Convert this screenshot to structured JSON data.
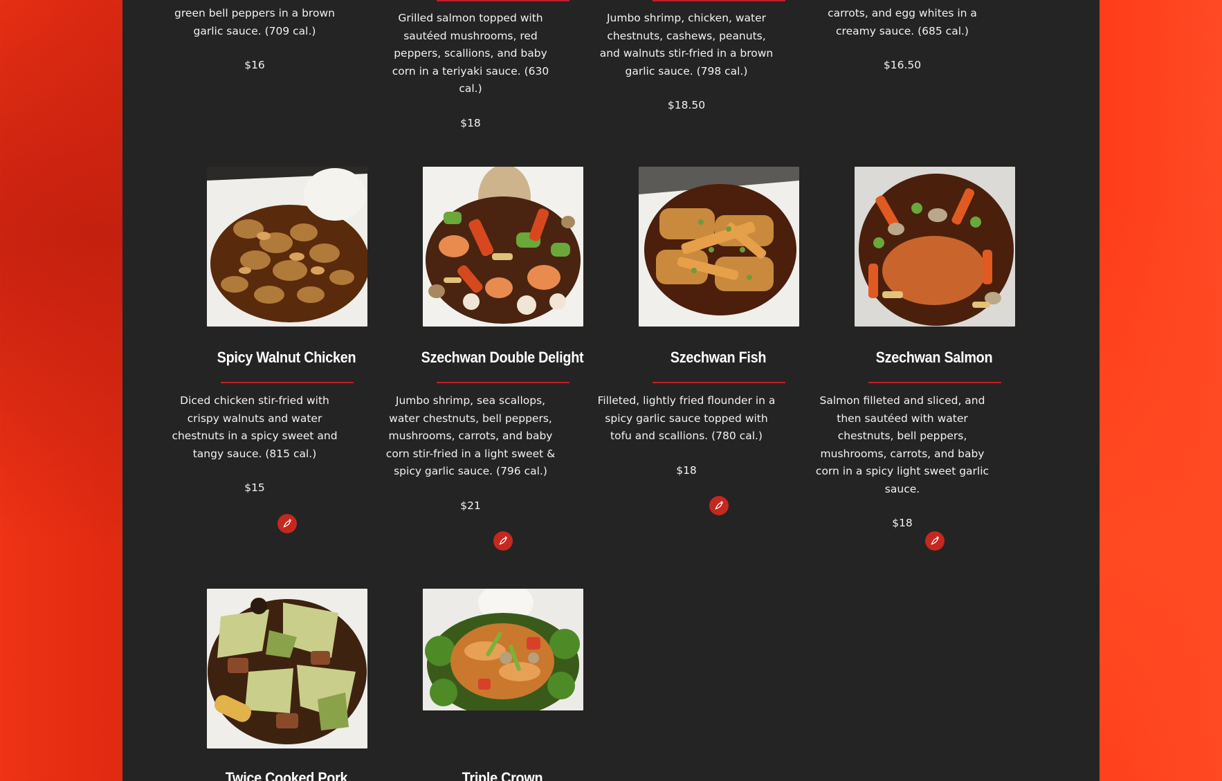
{
  "colors": {
    "background_red": "#e83014",
    "panel": "#242424",
    "accent": "#c41e2a",
    "spicy_badge": "#c5281f"
  },
  "top_row": [
    {
      "description": "green bell peppers in a brown garlic sauce. (709 cal.)",
      "price": "$16"
    },
    {
      "description": "Grilled salmon topped with sautéed mushrooms, red peppers, scallions, and baby corn in a teriyaki sauce. (630 cal.)",
      "price": "$18"
    },
    {
      "description": "Jumbo shrimp, chicken, water chestnuts, cashews, peanuts, and walnuts stir-fried in a brown garlic sauce. (798 cal.)",
      "price": "$18.50"
    },
    {
      "description": "carrots, and egg whites in a creamy sauce. (685 cal.)",
      "price": "$16.50"
    }
  ],
  "middle_row": [
    {
      "name": "Spicy Walnut Chicken",
      "description": "Diced chicken stir-fried with crispy walnuts and water chestnuts in a spicy sweet and tangy sauce. (815 cal.)",
      "price": "$15",
      "spicy_icon": "chili-pepper-icon"
    },
    {
      "name": "Szechwan Double Delight",
      "description": "Jumbo shrimp, sea scallops, water chestnuts, bell peppers, mushrooms, carrots, and baby corn stir-fried in a light sweet & spicy garlic sauce. (796 cal.)",
      "price": "$21",
      "spicy_icon": "chili-pepper-icon"
    },
    {
      "name": "Szechwan Fish",
      "description": "Filleted, lightly fried flounder in a spicy garlic sauce topped with tofu and scallions. (780 cal.)",
      "price": "$18",
      "spicy_icon": "chili-pepper-icon"
    },
    {
      "name": "Szechwan Salmon",
      "description": "Salmon filleted and sliced, and then sautéed with water chestnuts, bell peppers, mushrooms, carrots, and baby corn in a spicy light sweet garlic sauce.",
      "price": "$18",
      "spicy_icon": "chili-pepper-icon"
    }
  ],
  "bottom_row": [
    {
      "name": "Twice Cooked Pork"
    },
    {
      "name": "Triple Crown"
    }
  ]
}
